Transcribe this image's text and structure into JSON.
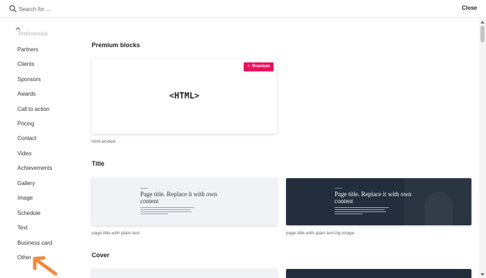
{
  "search": {
    "placeholder": "Search for ...",
    "value": ""
  },
  "header": {
    "close_label": "Close"
  },
  "sidebar": {
    "items": [
      {
        "label": "Testimonials",
        "faded": true
      },
      {
        "label": "Partners"
      },
      {
        "label": "Clients"
      },
      {
        "label": "Sponsors"
      },
      {
        "label": "Awards"
      },
      {
        "label": "Call to action"
      },
      {
        "label": "Pricing"
      },
      {
        "label": "Contact"
      },
      {
        "label": "Video"
      },
      {
        "label": "Achievements"
      },
      {
        "label": "Gallery"
      },
      {
        "label": "Image"
      },
      {
        "label": "Schedule"
      },
      {
        "label": "Text"
      },
      {
        "label": "Business card"
      },
      {
        "label": "Other"
      }
    ]
  },
  "sections": {
    "premium": {
      "title": "Premium blocks",
      "card": {
        "preview_text": "<HTML>",
        "badge": "Premium",
        "caption": "html-embed"
      }
    },
    "title": {
      "title": "Title",
      "cards": [
        {
          "preview_title": "Page title. Replace it with own content",
          "caption": "page-title-with-plain-text"
        },
        {
          "preview_title": "Page title. Replace it with own content",
          "caption": "page-title-with-plain-text-bg-image"
        }
      ]
    },
    "cover": {
      "title": "Cover"
    }
  },
  "colors": {
    "premium_badge": "#e8125c",
    "dark_card": "#232d3b",
    "light_card": "#f1f2f6",
    "pointer_arrow": "#f08a3c"
  },
  "icons": {
    "search": "search-icon",
    "collapse": "chevron-up-icon",
    "star": "star-icon",
    "pointer": "pointer-arrow-icon"
  }
}
